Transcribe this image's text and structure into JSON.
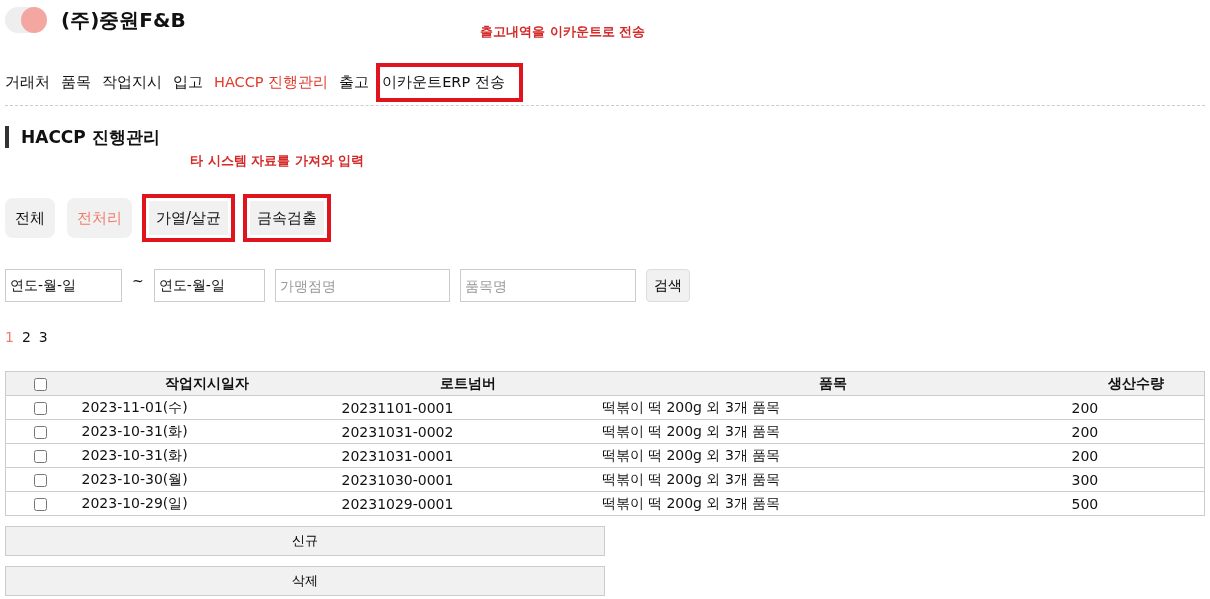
{
  "header": {
    "title": "(주)중원F&B",
    "toggle_on": true,
    "note": "출고내역을 이카운트로 전송"
  },
  "nav": [
    {
      "label": "거래처",
      "selected": false,
      "highlighted": false
    },
    {
      "label": "품목",
      "selected": false,
      "highlighted": false
    },
    {
      "label": "작업지시",
      "selected": false,
      "highlighted": false
    },
    {
      "label": "입고",
      "selected": false,
      "highlighted": false
    },
    {
      "label": "HACCP 진행관리",
      "selected": true,
      "highlighted": false
    },
    {
      "label": "출고",
      "selected": false,
      "highlighted": false
    },
    {
      "label": "이카운트ERP 전송",
      "selected": false,
      "highlighted": true
    }
  ],
  "section": {
    "title": "HACCP 진행관리",
    "note": "타 시스템 자료를 가져와 입력"
  },
  "filters": [
    {
      "label": "전체",
      "selected": false,
      "highlighted": false
    },
    {
      "label": "전처리",
      "selected": true,
      "highlighted": false
    },
    {
      "label": "가열/살균",
      "selected": false,
      "highlighted": true
    },
    {
      "label": "금속검출",
      "selected": false,
      "highlighted": true
    }
  ],
  "search": {
    "date_from": "연도-월-일",
    "separator": "~",
    "date_to": "연도-월-일",
    "store_placeholder": "가맹점명",
    "item_placeholder": "품목명",
    "button": "검색"
  },
  "pages": [
    {
      "label": "1",
      "selected": true
    },
    {
      "label": "2",
      "selected": false
    },
    {
      "label": "3",
      "selected": false
    }
  ],
  "table": {
    "select_all_checked": false,
    "columns": [
      "작업지시일자",
      "로트넘버",
      "품목",
      "생산수량"
    ],
    "rows": [
      {
        "checked": false,
        "cells": [
          "2023-11-01(수)",
          "20231101-0001",
          "떡볶이 떡 200g 외 3개 품목",
          "200"
        ]
      },
      {
        "checked": false,
        "cells": [
          "2023-10-31(화)",
          "20231031-0002",
          "떡볶이 떡 200g 외 3개 품목",
          "200"
        ]
      },
      {
        "checked": false,
        "cells": [
          "2023-10-31(화)",
          "20231031-0001",
          "떡볶이 떡 200g 외 3개 품목",
          "200"
        ]
      },
      {
        "checked": false,
        "cells": [
          "2023-10-30(월)",
          "20231030-0001",
          "떡볶이 떡 200g 외 3개 품목",
          "300"
        ]
      },
      {
        "checked": false,
        "cells": [
          "2023-10-29(일)",
          "20231029-0001",
          "떡볶이 떡 200g 외 3개 품목",
          "500"
        ]
      }
    ]
  },
  "actions": [
    "신규",
    "삭제"
  ]
}
